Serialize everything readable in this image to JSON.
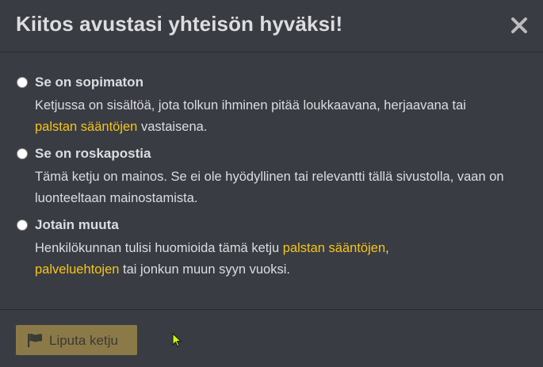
{
  "dialog": {
    "title": "Kiitos avustasi yhteisön hyväksi!",
    "close_icon": "close-icon"
  },
  "options": [
    {
      "title": "Se on sopimaton",
      "desc_parts": [
        "Ketjussa on sisältöä, jota tolkun ihminen pitää loukkaavana, herjaavana tai ",
        "palstan sääntöjen",
        " vastaisena."
      ]
    },
    {
      "title": "Se on roskapostia",
      "desc_parts": [
        "Tämä ketju on mainos. Se ei ole hyödyllinen tai relevantti tällä sivustolla, vaan on luonteeltaan mainostamista."
      ]
    },
    {
      "title": "Jotain muuta",
      "desc_parts": [
        "Henkilökunnan tulisi huomioida tämä ketju ",
        "palstan sääntöjen",
        ",",
        "palveluehtojen",
        " tai jonkun muun syyn vuoksi."
      ]
    }
  ],
  "footer": {
    "flag_button_label": "Liputa ketju",
    "flag_icon": "flag-icon"
  },
  "colors": {
    "background": "#3a3c43",
    "text": "#dcdde0",
    "link": "#f5c518",
    "button": "#8b7a48",
    "cursor": "#c8ff00"
  }
}
